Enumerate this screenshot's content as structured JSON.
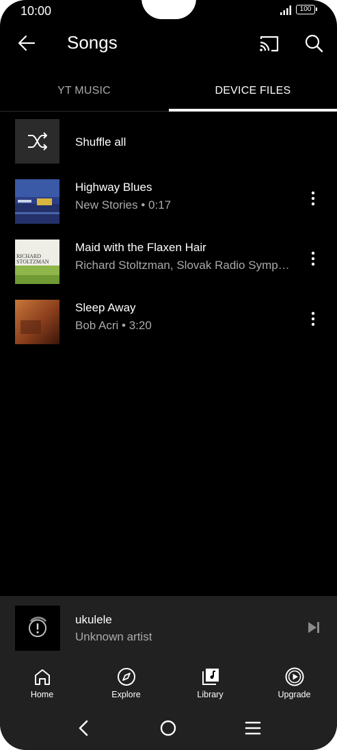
{
  "status": {
    "time": "10:00",
    "battery": "100"
  },
  "header": {
    "title": "Songs"
  },
  "tabs": [
    {
      "label": "YT MUSIC",
      "active": false
    },
    {
      "label": "DEVICE FILES",
      "active": true
    }
  ],
  "shuffle": {
    "label": "Shuffle all"
  },
  "songs": [
    {
      "title": "Highway Blues",
      "subtitle": "New Stories • 0:17"
    },
    {
      "title": "Maid with the Flaxen Hair",
      "subtitle": "Richard Stoltzman, Slovak Radio Symp…"
    },
    {
      "title": "Sleep Away",
      "subtitle": "Bob Acri • 3:20"
    }
  ],
  "album_text": {
    "richard": "RICHARD",
    "stoltzman": "STOLTZMAN"
  },
  "mini_player": {
    "title": "ukulele",
    "artist": "Unknown artist"
  },
  "bottom_nav": [
    {
      "label": "Home",
      "icon": "home-icon"
    },
    {
      "label": "Explore",
      "icon": "compass-icon"
    },
    {
      "label": "Library",
      "icon": "library-icon"
    },
    {
      "label": "Upgrade",
      "icon": "upgrade-icon"
    }
  ],
  "colors": {
    "background": "#000000",
    "surface": "#212121",
    "secondary_text": "#aaaaaa"
  }
}
